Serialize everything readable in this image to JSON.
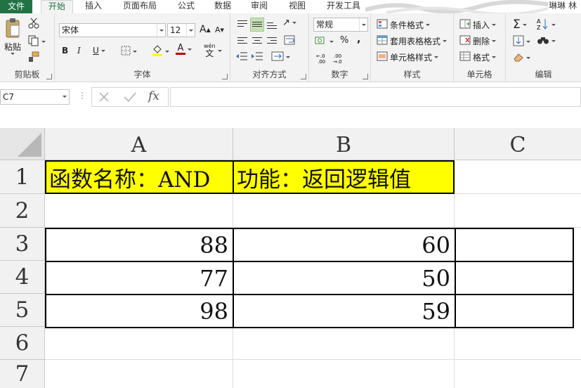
{
  "menu": {
    "file": "文件",
    "tabs": [
      "开始",
      "插入",
      "页面布局",
      "公式",
      "数据",
      "审阅",
      "视图",
      "开发工具"
    ],
    "active_tab": "开始",
    "user": "琳琳 林"
  },
  "ribbon": {
    "clipboard": {
      "label": "剪贴板",
      "paste": "粘贴"
    },
    "font": {
      "label": "字体",
      "font_name": "宋体",
      "font_size": "12",
      "bold": "B",
      "italic": "I",
      "underline": "U",
      "grow": "A",
      "shrink": "A",
      "color_letter": "A",
      "phonetic": "wén",
      "phonetic_char": "文"
    },
    "alignment": {
      "label": "对齐方式"
    },
    "number": {
      "label": "数字",
      "format": "常规",
      "percent": "%",
      "comma": ","
    },
    "styles": {
      "label": "样式",
      "conditional": "条件格式",
      "table": "套用表格格式",
      "cell_styles": "单元格样式"
    },
    "cells": {
      "label": "单元格",
      "insert": "插入",
      "delete": "删除",
      "format": "格式"
    },
    "editing": {
      "label": "编辑"
    }
  },
  "formula_bar": {
    "name_box": "C7",
    "dots": "⋮",
    "fx": "fx",
    "formula": ""
  },
  "grid": {
    "columns": [
      "A",
      "B",
      "C"
    ],
    "rows": [
      "1",
      "2",
      "3",
      "4",
      "5",
      "6",
      "7"
    ],
    "cells": {
      "A1": "函数名称：AND",
      "B1": "功能：返回逻辑值",
      "A3": "88",
      "B3": "60",
      "A4": "77",
      "B4": "50",
      "A5": "98",
      "B5": "59"
    }
  },
  "colors": {
    "excel_green": "#217346",
    "highlight_yellow": "#ffff00"
  }
}
